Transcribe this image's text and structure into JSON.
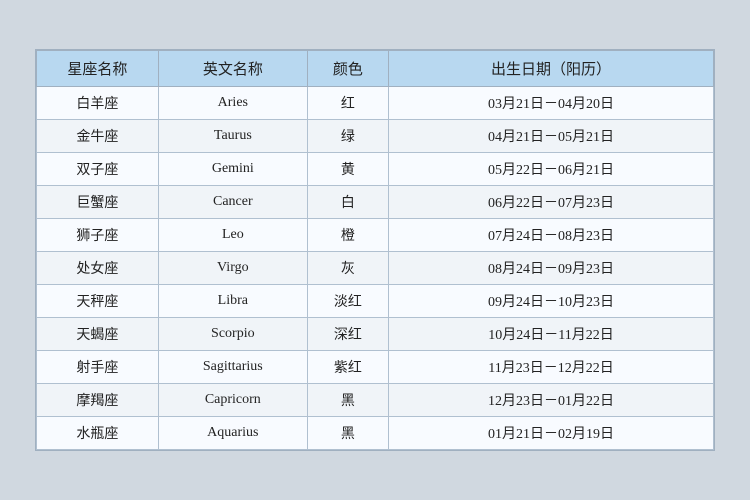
{
  "table": {
    "headers": {
      "col1": "星座名称",
      "col2": "英文名称",
      "col3": "颜色",
      "col4": "出生日期（阳历）"
    },
    "rows": [
      {
        "zh": "白羊座",
        "en": "Aries",
        "color": "红",
        "date": "03月21日－04月20日"
      },
      {
        "zh": "金牛座",
        "en": "Taurus",
        "color": "绿",
        "date": "04月21日－05月21日"
      },
      {
        "zh": "双子座",
        "en": "Gemini",
        "color": "黄",
        "date": "05月22日－06月21日"
      },
      {
        "zh": "巨蟹座",
        "en": "Cancer",
        "color": "白",
        "date": "06月22日－07月23日"
      },
      {
        "zh": "狮子座",
        "en": "Leo",
        "color": "橙",
        "date": "07月24日－08月23日"
      },
      {
        "zh": "处女座",
        "en": "Virgo",
        "color": "灰",
        "date": "08月24日－09月23日"
      },
      {
        "zh": "天秤座",
        "en": "Libra",
        "color": "淡红",
        "date": "09月24日－10月23日"
      },
      {
        "zh": "天蝎座",
        "en": "Scorpio",
        "color": "深红",
        "date": "10月24日－11月22日"
      },
      {
        "zh": "射手座",
        "en": "Sagittarius",
        "color": "紫红",
        "date": "11月23日－12月22日"
      },
      {
        "zh": "摩羯座",
        "en": "Capricorn",
        "color": "黑",
        "date": "12月23日－01月22日"
      },
      {
        "zh": "水瓶座",
        "en": "Aquarius",
        "color": "黑",
        "date": "01月21日－02月19日"
      }
    ]
  }
}
